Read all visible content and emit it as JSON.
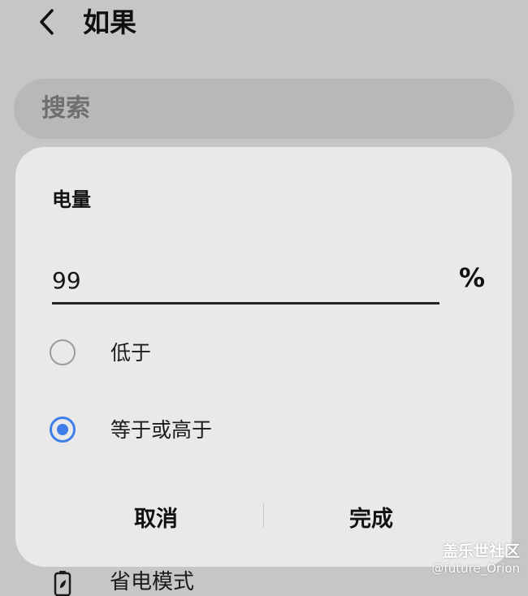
{
  "header": {
    "title": "如果",
    "back_icon": "chevron-left-icon"
  },
  "search": {
    "placeholder": "搜索",
    "background": "#b8b8b8"
  },
  "background_list": {
    "item_label": "省电模式",
    "item_icon": "battery-icon"
  },
  "dialog": {
    "title": "电量",
    "value": "99",
    "unit": "%",
    "options": [
      {
        "label": "低于",
        "selected": false
      },
      {
        "label": "等于或高于",
        "selected": true
      }
    ],
    "cancel_label": "取消",
    "done_label": "完成"
  },
  "colors": {
    "accent": "#3d7ee8",
    "dialog_background": "#e9e9e9",
    "screen_background": "#c6c6c6"
  },
  "watermark": {
    "title": "盖乐世社区",
    "user": "@future_Orion"
  }
}
